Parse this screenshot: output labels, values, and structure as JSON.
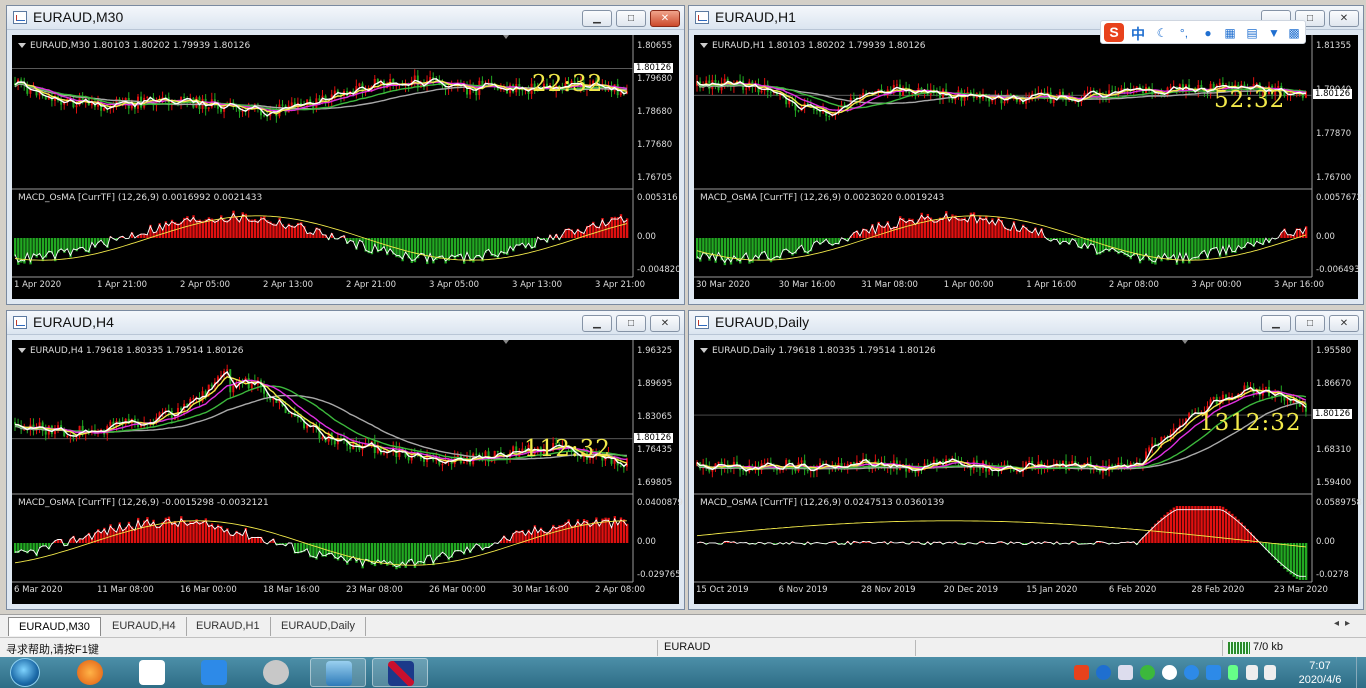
{
  "windows": [
    {
      "id": "m30",
      "title": "EURAUD,M30",
      "ohlc": "EURAUD,M30  1.80103 1.80202 1.79939 1.80126",
      "macd_label": "MACD_OsMA [CurrTF] (12,26,9) 0.0016992 0.0021433",
      "timer": "22:32",
      "current_price": "1.80126",
      "price_labels": [
        "1.80655",
        "1.79680",
        "1.78680",
        "1.77680",
        "1.76705"
      ],
      "macd_labels": [
        "0.005316",
        "0.00",
        "-0.004820"
      ],
      "time_labels": [
        "1 Apr 2020",
        "1 Apr 21:00",
        "2 Apr 05:00",
        "2 Apr 13:00",
        "2 Apr 21:00",
        "3 Apr 05:00",
        "3 Apr 13:00",
        "3 Apr 21:00"
      ]
    },
    {
      "id": "h1",
      "title": "EURAUD,H1",
      "ohlc": "EURAUD,H1  1.80103 1.80202 1.79939 1.80126",
      "macd_label": "MACD_OsMA [CurrTF] (12,26,9) 0.0023020 0.0019243",
      "timer": "52:32",
      "current_price": "1.80126",
      "price_labels": [
        "1.81355",
        "1.79040",
        "1.77870",
        "1.76700"
      ],
      "macd_labels": [
        "0.0057672",
        "0.00",
        "-0.006493"
      ],
      "time_labels": [
        "30 Mar 2020",
        "30 Mar 16:00",
        "31 Mar 08:00",
        "1 Apr 00:00",
        "1 Apr 16:00",
        "2 Apr 08:00",
        "3 Apr 00:00",
        "3 Apr 16:00"
      ]
    },
    {
      "id": "h4",
      "title": "EURAUD,H4",
      "ohlc": "EURAUD,H4  1.79618 1.80335 1.79514 1.80126",
      "macd_label": "MACD_OsMA [CurrTF] (12,26,9) -0.0015298 -0.0032121",
      "timer": "112:32",
      "current_price": "1.80126",
      "price_labels": [
        "1.96325",
        "1.89695",
        "1.83065",
        "1.76435",
        "1.69805"
      ],
      "macd_labels": [
        "0.0400879",
        "0.00",
        "-0.029765"
      ],
      "time_labels": [
        "6 Mar 2020",
        "11 Mar 08:00",
        "16 Mar 00:00",
        "18 Mar 16:00",
        "23 Mar 08:00",
        "26 Mar 00:00",
        "30 Mar 16:00",
        "2 Apr 08:00"
      ]
    },
    {
      "id": "daily",
      "title": "EURAUD,Daily",
      "ohlc": "EURAUD,Daily  1.79618 1.80335 1.79514 1.80126",
      "macd_label": "MACD_OsMA [CurrTF] (12,26,9) 0.0247513 0.0360139",
      "timer": "1312:32",
      "current_price": "1.80126",
      "price_labels": [
        "1.95580",
        "1.86670",
        "1.77490",
        "1.68310",
        "1.59400"
      ],
      "macd_labels": [
        "0.0589758",
        "0.00",
        "-0.0278"
      ],
      "time_labels": [
        "15 Oct 2019",
        "6 Nov 2019",
        "28 Nov 2019",
        "20 Dec 2019",
        "15 Jan 2020",
        "6 Feb 2020",
        "28 Feb 2020",
        "23 Mar 2020"
      ]
    }
  ],
  "tabs": [
    "EURAUD,M30",
    "EURAUD,H4",
    "EURAUD,H1",
    "EURAUD,Daily"
  ],
  "status": {
    "help": "寻求帮助,请按F1键",
    "symbol": "EURAUD",
    "traffic": "7/0 kb"
  },
  "ime": {
    "label": "中"
  },
  "clock": {
    "time": "7:07",
    "date": "2020/4/6"
  },
  "colors": {
    "bull": "#e01010",
    "bear": "#22a822",
    "ma_fast": "#ffffff",
    "ma_yellow": "#f2e94a",
    "ma_magenta": "#e030e0",
    "ma_green": "#3cb83c",
    "ma_gray": "#a8a8a8",
    "timer": "#f2e94a"
  }
}
